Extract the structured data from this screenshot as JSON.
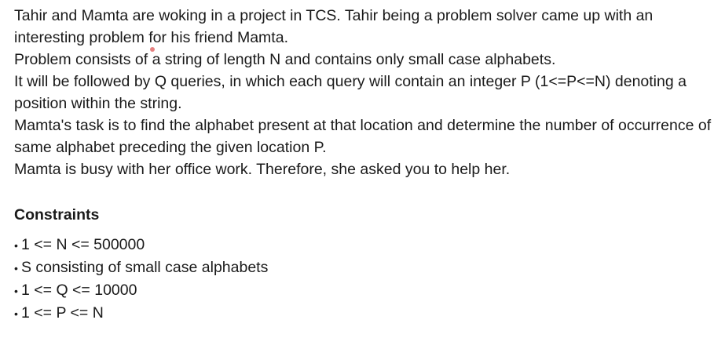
{
  "paragraphs": [
    "Tahir and Mamta are woking in a project in TCS. Tahir being a problem solver came up with an interesting problem for his friend Mamta.",
    "Problem consists of a string of length N and contains only small case alphabets.",
    "It will be followed by Q queries, in which each query will contain an integer P (1<=P<=N) denoting a position within the string.",
    "Mamta's task is to find the alphabet present at that location and determine the number of occurrence of same alphabet preceding the given location P.",
    "Mamta is busy with her office work. Therefore, she asked you to help her."
  ],
  "constraints": {
    "heading": "Constraints",
    "bullet": "•",
    "items": [
      "1 <= N <= 500000",
      "S consisting of small case alphabets",
      "1 <= Q <= 10000",
      "1 <= P <= N"
    ]
  },
  "colors": {
    "text": "#1a1a1a",
    "cursor": "#e06a6a"
  }
}
